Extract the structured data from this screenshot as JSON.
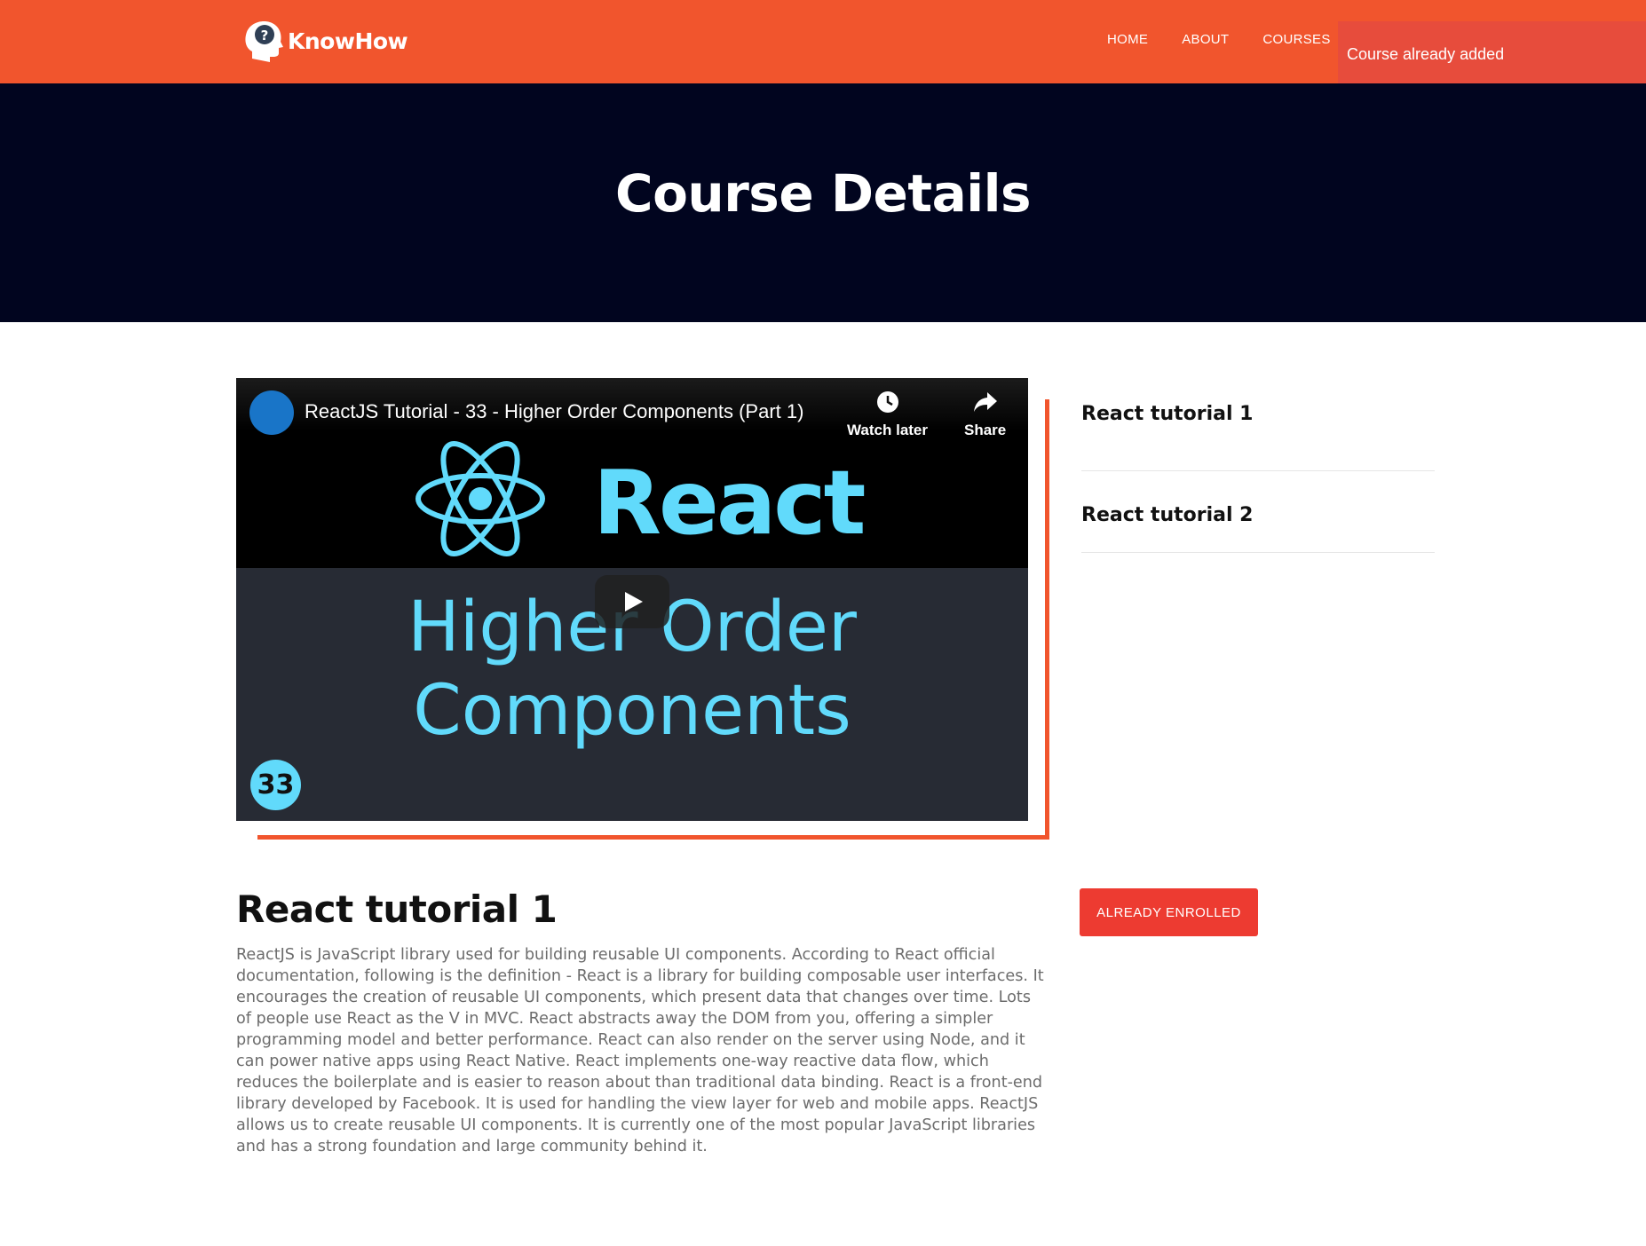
{
  "brand": {
    "name": "KnowHow",
    "icon": "head-question-icon"
  },
  "nav": {
    "items": [
      {
        "label": "HOME"
      },
      {
        "label": "ABOUT"
      },
      {
        "label": "COURSES",
        "has_dropdown": true
      }
    ]
  },
  "toast": {
    "message": "Course already added",
    "color": "#e74c3c"
  },
  "hero": {
    "title": "Course Details"
  },
  "video": {
    "title": "ReactJS Tutorial - 33 - Higher Order Components (Part 1)",
    "watch_later_label": "Watch later",
    "share_label": "Share",
    "thumbnail": {
      "brand_word": "React",
      "line1": "Higher Order",
      "line2": "Components",
      "episode": "33"
    }
  },
  "sidebar": {
    "lessons": [
      {
        "label": "React tutorial 1"
      },
      {
        "label": "React tutorial 2"
      }
    ]
  },
  "course": {
    "title": "React tutorial 1",
    "enroll_label": "ALREADY ENROLLED",
    "description": "ReactJS is JavaScript library used for building reusable UI components. According to React official documentation, following is the definition - React is a library for building composable user interfaces. It encourages the creation of reusable UI components, which present data that changes over time. Lots of people use React as the V in MVC. React abstracts away the DOM from you, offering a simpler programming model and better performance. React can also render on the server using Node, and it can power native apps using React Native. React implements one-way reactive data flow, which reduces the boilerplate and is easier to reason about than traditional data binding. React is a front-end library developed by Facebook. It is used for handling the view layer for web and mobile apps. ReactJS allows us to create reusable UI components. It is currently one of the most popular JavaScript libraries and has a strong foundation and large community behind it."
  },
  "colors": {
    "accent": "#f1552d",
    "hero_bg": "#01051f",
    "button": "#ed3b31",
    "react_blue": "#61dafb"
  }
}
